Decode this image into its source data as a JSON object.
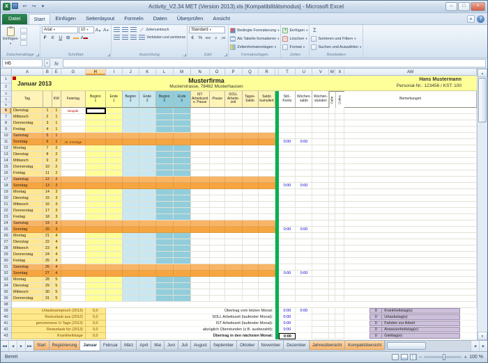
{
  "window": {
    "title": "Activity_V2.34 MET (Version 2013).xls [Kompatibilitätsmodus] - Microsoft Excel"
  },
  "icons": {
    "dropdown": "▾",
    "close": "×",
    "maximize": "□",
    "minimize": "–",
    "help": "?",
    "undo": "↩",
    "redo": "↪",
    "up_arrow": "▲",
    "down_arrow": "▼",
    "left_arrow": "◀",
    "right_arrow": "▶",
    "first_tab": "◀◀",
    "last_tab": "▶▶",
    "sigma": "Σ",
    "borders": "⊞",
    "excel_x": "X",
    "min_ribbon": "▲"
  },
  "ribbon": {
    "file_tab": "Datei",
    "tabs": [
      "Start",
      "Einfügen",
      "Seitenlayout",
      "Formeln",
      "Daten",
      "Überprüfen",
      "Ansicht"
    ],
    "active_tab": "Start",
    "paste_label": "Einfügen",
    "groups": [
      "Zwischenablage",
      "Schriftart",
      "Ausrichtung",
      "Zahl",
      "Formatvorlagen",
      "Zellen",
      "Bearbeiten"
    ],
    "font_name": "Arial",
    "font_size": "10",
    "wrap_label": "Zeilenumbruch",
    "merge_label": "Verbinden und zentrieren",
    "number_format": "Standard",
    "styles": [
      "Bedingte Formatierung",
      "Als Tabelle formatieren",
      "Zellenformatvorlagen"
    ],
    "cells": [
      "Einfügen",
      "Löschen",
      "Format"
    ],
    "editing": [
      "Sortieren und Filtern",
      "Suchen und Auswählen"
    ]
  },
  "formula_bar": {
    "name_box": "H6",
    "fx": "fx",
    "value": ""
  },
  "grid": {
    "columns": [
      "A",
      "B",
      "E",
      "G",
      "H",
      "I",
      "J",
      "K",
      "L",
      "M",
      "N",
      "O",
      "P",
      "Q",
      "R",
      "S",
      "T",
      "U",
      "V",
      "W",
      "X",
      "AW"
    ],
    "selected_column": "H",
    "selected_row": 6,
    "title": {
      "month": "Januar 2013",
      "company": "Musterfirma",
      "address": "Musterstrasse, 78462 Musterhausen",
      "employee": "Hans Mustermann",
      "personal": "Personal-Nr.: 123456 / KST: 100"
    },
    "headers": {
      "tag": "Tag",
      "kw": "KW",
      "feiertag": "Feiertag",
      "time": [
        "Beginn\n1",
        "Ende\n1",
        "Beginn\n2",
        "Ende\n2",
        "Beginn\n3",
        "Ende\n3"
      ],
      "ist": "IST\nArbeitszeit\no. Pause",
      "pause": "-Pause",
      "soll": "SOLL\nArbeits-\nzeit",
      "tagessaldo": "Tages-\nSaldo",
      "saldokum": "Saldo\nkumuliert",
      "stdkonto": "Std.-\nKonto",
      "wochensaldo": "Wochen-\nsaldo",
      "wochenstunden": "Wochen-\nstunden",
      "fahrt": "Fahrt",
      "codes": "Codes",
      "bemerkungen": "Bemerkungen"
    },
    "sunday_values": {
      "stdkonto": "0:00",
      "wochensaldo": "0:00"
    },
    "days": [
      {
        "d": "Dienstag",
        "n": 1,
        "k": 1,
        "h": "Neujahr",
        "t": "wd"
      },
      {
        "d": "Mittwoch",
        "n": 2,
        "k": 1,
        "h": "",
        "t": "wd"
      },
      {
        "d": "Donnerstag",
        "n": 3,
        "k": 1,
        "h": "",
        "t": "wd"
      },
      {
        "d": "Freitag",
        "n": 4,
        "k": 1,
        "h": "",
        "t": "wd"
      },
      {
        "d": "Samstag",
        "n": 5,
        "k": 1,
        "h": "",
        "t": "sa"
      },
      {
        "d": "Sonntag",
        "n": 6,
        "k": 1,
        "h": "Hl. 3 Könige",
        "t": "so"
      },
      {
        "d": "Montag",
        "n": 7,
        "k": 2,
        "h": "",
        "t": "wd"
      },
      {
        "d": "Dienstag",
        "n": 8,
        "k": 2,
        "h": "",
        "t": "wd"
      },
      {
        "d": "Mittwoch",
        "n": 9,
        "k": 2,
        "h": "",
        "t": "wd"
      },
      {
        "d": "Donnerstag",
        "n": 10,
        "k": 2,
        "h": "",
        "t": "wd"
      },
      {
        "d": "Freitag",
        "n": 11,
        "k": 2,
        "h": "",
        "t": "wd"
      },
      {
        "d": "Samstag",
        "n": 12,
        "k": 2,
        "h": "",
        "t": "sa"
      },
      {
        "d": "Sonntag",
        "n": 13,
        "k": 2,
        "h": "",
        "t": "so"
      },
      {
        "d": "Montag",
        "n": 14,
        "k": 3,
        "h": "",
        "t": "wd"
      },
      {
        "d": "Dienstag",
        "n": 15,
        "k": 3,
        "h": "",
        "t": "wd"
      },
      {
        "d": "Mittwoch",
        "n": 16,
        "k": 3,
        "h": "",
        "t": "wd"
      },
      {
        "d": "Donnerstag",
        "n": 17,
        "k": 3,
        "h": "",
        "t": "wd"
      },
      {
        "d": "Freitag",
        "n": 18,
        "k": 3,
        "h": "",
        "t": "wd"
      },
      {
        "d": "Samstag",
        "n": 19,
        "k": 3,
        "h": "",
        "t": "sa"
      },
      {
        "d": "Sonntag",
        "n": 20,
        "k": 3,
        "h": "",
        "t": "so"
      },
      {
        "d": "Montag",
        "n": 21,
        "k": 4,
        "h": "",
        "t": "wd"
      },
      {
        "d": "Dienstag",
        "n": 22,
        "k": 4,
        "h": "",
        "t": "wd"
      },
      {
        "d": "Mittwoch",
        "n": 23,
        "k": 4,
        "h": "",
        "t": "wd"
      },
      {
        "d": "Donnerstag",
        "n": 24,
        "k": 4,
        "h": "",
        "t": "wd"
      },
      {
        "d": "Freitag",
        "n": 25,
        "k": 4,
        "h": "",
        "t": "wd"
      },
      {
        "d": "Samstag",
        "n": 26,
        "k": 4,
        "h": "",
        "t": "sa"
      },
      {
        "d": "Sonntag",
        "n": 27,
        "k": 4,
        "h": "",
        "t": "so"
      },
      {
        "d": "Montag",
        "n": 28,
        "k": 5,
        "h": "",
        "t": "wd"
      },
      {
        "d": "Dienstag",
        "n": 29,
        "k": 5,
        "h": "",
        "t": "wd"
      },
      {
        "d": "Mittwoch",
        "n": 30,
        "k": 5,
        "h": "",
        "t": "wd"
      },
      {
        "d": "Donnerstag",
        "n": 31,
        "k": 5,
        "h": "",
        "t": "wd"
      }
    ],
    "summary": {
      "left": [
        {
          "label": "Urlaubsanspruch (2013)",
          "value": "0,0"
        },
        {
          "label": "Resturlaub aus (2012)",
          "value": "0,0"
        },
        {
          "label": "genommene U-Tage (2013)",
          "value": "0,0"
        },
        {
          "label": "Resturlaub für (2013)",
          "value": "0,0"
        },
        {
          "label": "Krankheitstage",
          "value": "0,0"
        }
      ],
      "center": [
        {
          "label": "Übertrag vom letzten Monat:",
          "values": [
            "0:00",
            "0:00"
          ]
        },
        {
          "label": "SOLL Arbeitszeit (laufender Monat):",
          "values": [
            "0:00"
          ]
        },
        {
          "label": "IST Arbeitszeit (laufender Monat):",
          "values": [
            "0:00"
          ]
        },
        {
          "label": "abzüglich Überstunden (z.B. ausbezahlt):",
          "values": [
            "0:00"
          ]
        },
        {
          "label": "Übertrag in den nächsten Monat:",
          "values": [
            "0:00"
          ],
          "bold": true
        }
      ],
      "right": [
        {
          "value": "0",
          "label": "Krankheitstag(e)"
        },
        {
          "value": "0",
          "label": "Urlaubstag(e)"
        },
        {
          "value": "0",
          "label": "Fahrten zur Arbeit"
        },
        {
          "value": "0",
          "label": "Anwesenheitstag(e)"
        },
        {
          "value": "0",
          "label": "Gleittag(e)"
        }
      ]
    }
  },
  "sheet_tabs": [
    {
      "label": "Start",
      "color": "#F6B26B"
    },
    {
      "label": "Registrierung",
      "color": "#F6B26B"
    },
    {
      "label": "Januar",
      "active": true
    },
    {
      "label": "Februar"
    },
    {
      "label": "März"
    },
    {
      "label": "April"
    },
    {
      "label": "Mai"
    },
    {
      "label": "Juni"
    },
    {
      "label": "Juli"
    },
    {
      "label": "August"
    },
    {
      "label": "September"
    },
    {
      "label": "Oktober"
    },
    {
      "label": "November"
    },
    {
      "label": "Dezember"
    },
    {
      "label": "Jahresübersicht",
      "color": "#F6B26B"
    },
    {
      "label": "Kompaktübersicht",
      "color": "#F6B26B"
    }
  ],
  "status_bar": {
    "mode": "Bereit",
    "zoom": "100 %"
  },
  "colors": {
    "title_bg": "#FFFF99",
    "weekday_label": "#FFE794",
    "time1": "#FFFF99",
    "time2": "#C9E7F1",
    "time3": "#92CDDC",
    "saturday": "#F9B566",
    "sunday": "#F6A540",
    "divider_green": "#00B050",
    "summary_left_bg": "#FFE88C",
    "summary_right_bg": "#CCC0DA",
    "value_blue": "#0000CC",
    "holiday_red": "#C00000"
  }
}
